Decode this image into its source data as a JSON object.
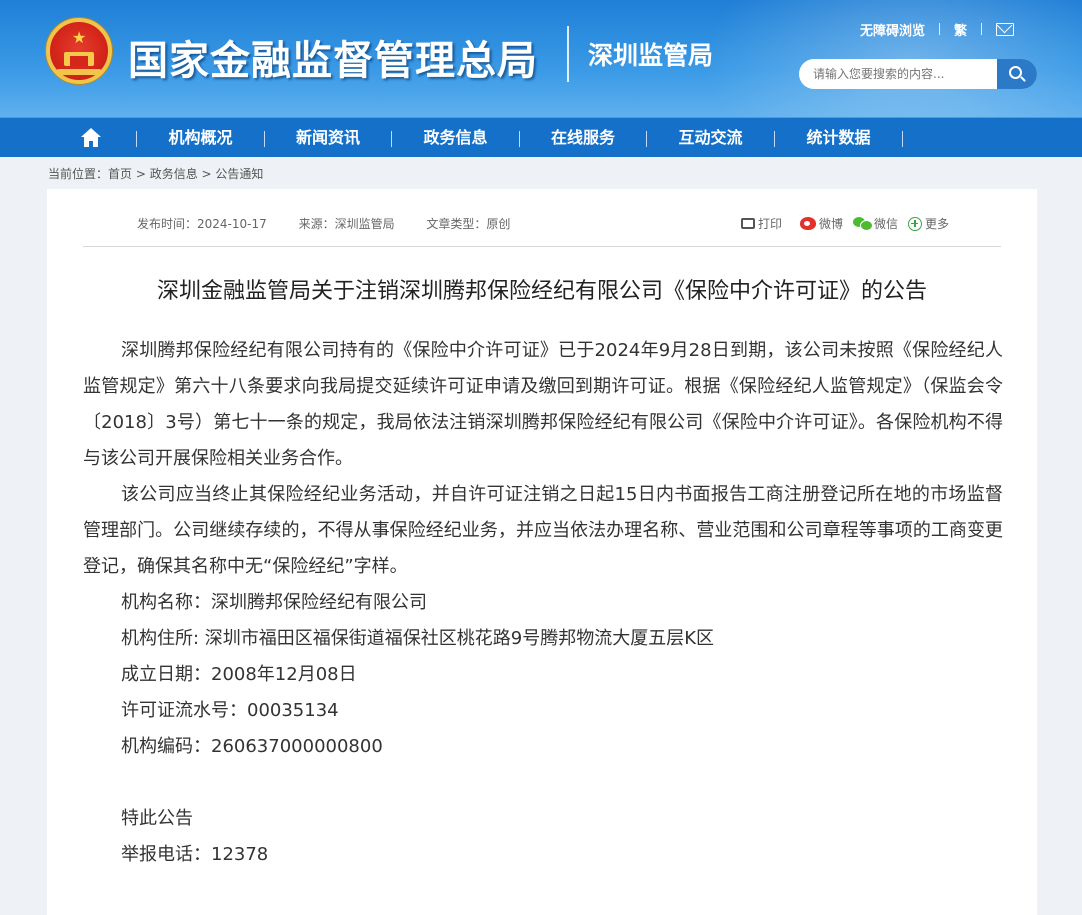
{
  "header": {
    "site_title": "国家金融监督管理总局",
    "sub_title": "深圳监管局",
    "accessibility_link": "无障碍浏览",
    "traditional_link": "繁",
    "search_placeholder": "请输入您要搜索的内容..."
  },
  "nav": {
    "items": [
      "机构概况",
      "新闻资讯",
      "政务信息",
      "在线服务",
      "互动交流",
      "统计数据"
    ]
  },
  "breadcrumb": {
    "prefix": "当前位置：",
    "items": [
      "首页",
      "政务信息",
      "公告通知"
    ],
    "separator": " > "
  },
  "meta": {
    "publish_time": "发布时间：2024-10-17",
    "source": "来源：深圳监管局",
    "type": "文章类型：原创"
  },
  "share": {
    "print": "打印",
    "weibo": "微博",
    "wechat": "微信",
    "more": "更多"
  },
  "article": {
    "title": "深圳金融监管局关于注销深圳腾邦保险经纪有限公司《保险中介许可证》的公告",
    "paragraphs": [
      "深圳腾邦保险经纪有限公司持有的《保险中介许可证》已于2024年9月28日到期，该公司未按照《保险经纪人监管规定》第六十八条要求向我局提交延续许可证申请及缴回到期许可证。根据《保险经纪人监管规定》（保监会令〔2018〕3号）第七十一条的规定，我局依法注销深圳腾邦保险经纪有限公司《保险中介许可证》。各保险机构不得与该公司开展保险相关业务合作。",
      "该公司应当终止其保险经纪业务活动，并自许可证注销之日起15日内书面报告工商注册登记所在地的市场监督管理部门。公司继续存续的，不得从事保险经纪业务，并应当依法办理名称、营业范围和公司章程等事项的工商变更登记，确保其名称中无“保险经纪”字样。"
    ],
    "org_name": "机构名称：深圳腾邦保险经纪有限公司",
    "org_address": "机构住所: 深圳市福田区福保街道福保社区桃花路9号腾邦物流大厦五层K区",
    "founded_date": "成立日期：2008年12月08日",
    "license_serial": "许可证流水号：00035134",
    "org_code": "机构编码：260637000000800",
    "closing": "特此公告",
    "hotline": "举报电话：12378"
  },
  "colors": {
    "header_blue": "#1f7fd6",
    "nav_blue": "#1470c9",
    "page_bg": "#eef1f5"
  }
}
